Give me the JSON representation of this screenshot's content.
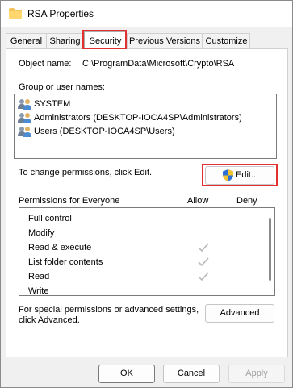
{
  "window": {
    "title": "RSA Properties",
    "icon": "folder-icon"
  },
  "tabs": [
    {
      "label": "General",
      "active": false
    },
    {
      "label": "Sharing",
      "active": false
    },
    {
      "label": "Security",
      "active": true
    },
    {
      "label": "Previous Versions",
      "active": false
    },
    {
      "label": "Customize",
      "active": false
    }
  ],
  "security": {
    "object_name_label": "Object name:",
    "object_name_value": "C:\\ProgramData\\Microsoft\\Crypto\\RSA",
    "group_label": "Group or user names:",
    "users": [
      {
        "name": "SYSTEM",
        "icon": "users-group-icon"
      },
      {
        "name": "Administrators (DESKTOP-IOCA4SP\\Administrators)",
        "icon": "users-group-icon"
      },
      {
        "name": "Users (DESKTOP-IOCA4SP\\Users)",
        "icon": "users-group-icon"
      }
    ],
    "change_text": "To change permissions, click Edit.",
    "edit_button": "Edit...",
    "permissions_header": "Permissions for Everyone",
    "allow_header": "Allow",
    "deny_header": "Deny",
    "permissions": [
      {
        "name": "Full control",
        "allow": false,
        "deny": false
      },
      {
        "name": "Modify",
        "allow": false,
        "deny": false
      },
      {
        "name": "Read & execute",
        "allow": true,
        "deny": false
      },
      {
        "name": "List folder contents",
        "allow": true,
        "deny": false
      },
      {
        "name": "Read",
        "allow": true,
        "deny": false
      },
      {
        "name": "Write",
        "allow": false,
        "deny": false
      }
    ],
    "advanced_text": "For special permissions or advanced settings, click Advanced.",
    "advanced_text_line1": "For special permissions or advanced settings,",
    "advanced_text_line2": "click Advanced.",
    "advanced_button": "Advanced"
  },
  "footer": {
    "ok": "OK",
    "cancel": "Cancel",
    "apply": "Apply"
  },
  "colors": {
    "highlight": "#e03030",
    "check": "#b8b8b8"
  }
}
